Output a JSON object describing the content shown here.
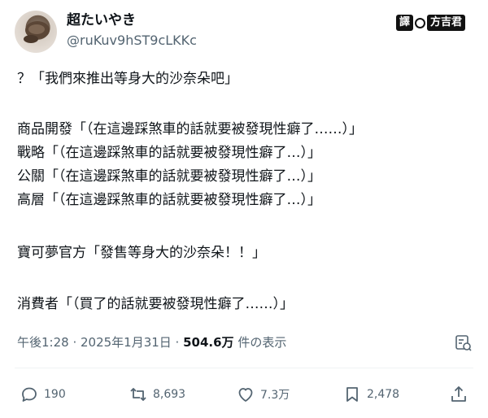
{
  "user": {
    "display_name": "超たいやき",
    "handle": "@ruKuv9hST9cLKKc"
  },
  "watermark": {
    "left": "譯",
    "right": "方吉君"
  },
  "post": {
    "lines": [
      "？「我們來推出等身大的沙奈朵吧」",
      "商品開發「（在這邊踩煞車的話就要被發現性癖了……）」",
      "戰略「（在這邊踩煞車的話就要被發現性癖了…）」",
      "公關「（在這邊踩煞車的話就要被發現性癖了…）」",
      "高層「（在這邊踩煞車的話就要被發現性癖了…）」",
      "寶可夢官方「發售等身大的沙奈朵！！」",
      "消費者「（買了的話就要被發現性癖了……）」"
    ]
  },
  "meta": {
    "timestamp": "午後1:28 · 2025年1月31日 · ",
    "views": "504.6万",
    "views_suffix": " 件の表示"
  },
  "actions": {
    "replies": "190",
    "reposts": "8,693",
    "likes": "7.3万",
    "bookmarks": "2,478"
  },
  "icons": {
    "avatar": "avatar-image",
    "stats": "stats-icon",
    "reply": "reply-icon",
    "repost": "repost-icon",
    "like": "heart-icon",
    "bookmark": "bookmark-icon",
    "share": "share-icon"
  }
}
